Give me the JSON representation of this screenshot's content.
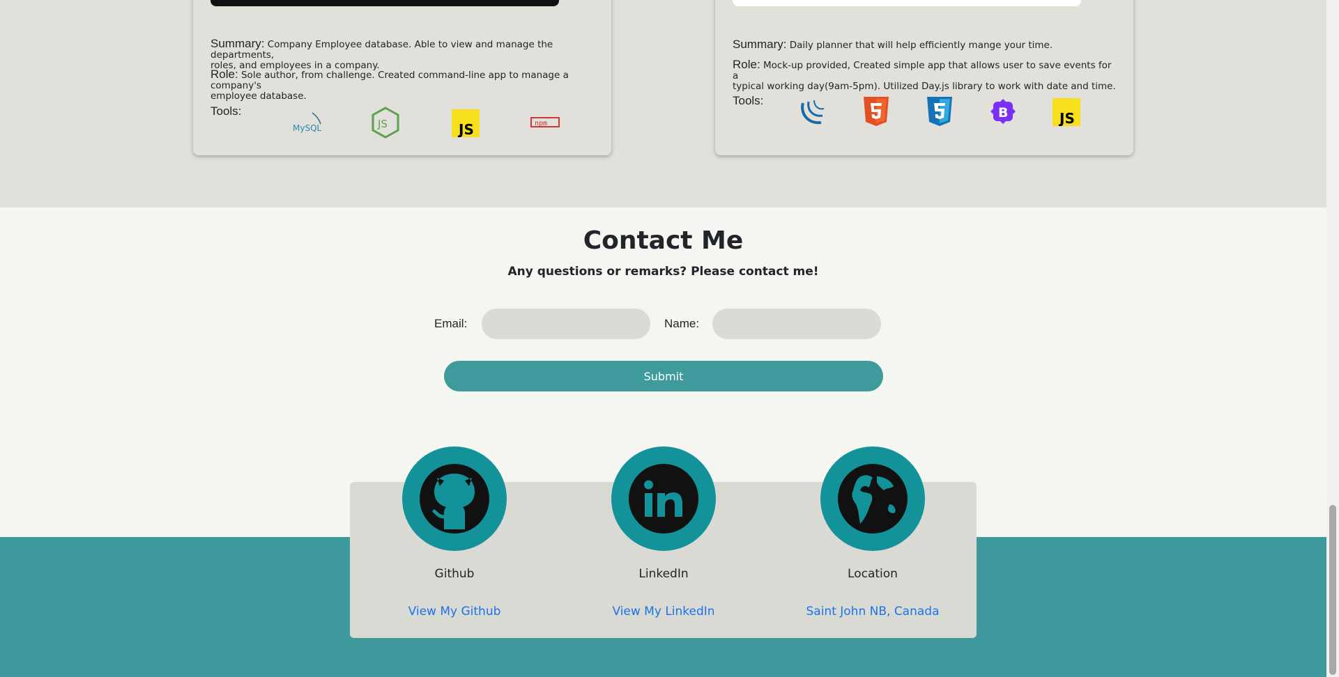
{
  "projects": [
    {
      "summary_label": "Summary:",
      "summary": "Company Employee database. Able to view and manage the departments,",
      "summary_line2": "roles, and employees in a company.",
      "role_label": "Role:",
      "role": "Sole author, from challenge. Created command-line app to manage a company's",
      "role_line2": "employee database.",
      "tools_label": "Tools:",
      "tools": [
        "mysql-icon",
        "nodejs-icon",
        "javascript-icon",
        "npm-icon"
      ]
    },
    {
      "summary_label": "Summary:",
      "summary": "Daily planner that will help efficiently mange your time.",
      "role_label": "Role:",
      "role": "Mock-up provided, Created simple app that allows user to save events for a",
      "role_line2": "typical working day(9am-5pm). Utilized Day.js library to work with date and time.",
      "tools_label": "Tools:",
      "tools": [
        "jquery-icon",
        "html5-icon",
        "css3-icon",
        "bootstrap-icon",
        "javascript-icon"
      ]
    }
  ],
  "logos": {
    "mysql": "MySQL",
    "js": "JS",
    "npm": "npm",
    "bootstrap": "B"
  },
  "contact": {
    "title": "Contact Me",
    "subtitle": "Any questions or remarks? Please contact me!",
    "email_label": "Email:",
    "email_value": "",
    "name_label": "Name:",
    "name_value": "",
    "submit_label": "Submit"
  },
  "socials": [
    {
      "title": "Github",
      "link_text": "View My Github",
      "icon": "github-icon"
    },
    {
      "title": "LinkedIn",
      "link_text": "View My LinkedIn",
      "icon": "linkedin-icon"
    },
    {
      "title": "Location",
      "link_text": "Saint John NB, Canada",
      "icon": "globe-icon"
    }
  ],
  "colors": {
    "section_bg": "#e1e0da",
    "page_bg": "#f5f5f1",
    "accent": "#3f9a9e",
    "social_circle": "#13929a",
    "link": "#1a73e8"
  }
}
